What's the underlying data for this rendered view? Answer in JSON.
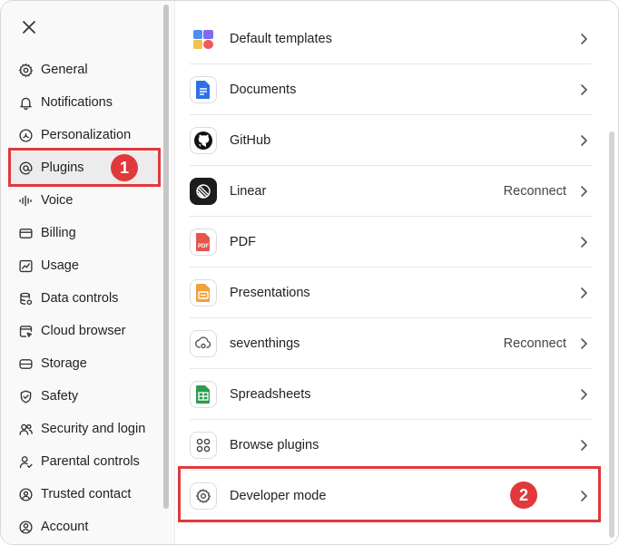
{
  "sidebar": {
    "items": [
      {
        "label": "General",
        "icon": "gear-icon"
      },
      {
        "label": "Notifications",
        "icon": "bell-icon"
      },
      {
        "label": "Personalization",
        "icon": "personalization-icon"
      },
      {
        "label": "Plugins",
        "icon": "at-sign-icon",
        "active": true
      },
      {
        "label": "Voice",
        "icon": "voice-waveform-icon"
      },
      {
        "label": "Billing",
        "icon": "card-icon"
      },
      {
        "label": "Usage",
        "icon": "chart-icon"
      },
      {
        "label": "Data controls",
        "icon": "database-icon"
      },
      {
        "label": "Cloud browser",
        "icon": "browser-icon"
      },
      {
        "label": "Storage",
        "icon": "storage-icon"
      },
      {
        "label": "Safety",
        "icon": "shield-icon"
      },
      {
        "label": "Security and login",
        "icon": "people-icon"
      },
      {
        "label": "Parental controls",
        "icon": "person-check-icon"
      },
      {
        "label": "Trusted contact",
        "icon": "contact-icon"
      },
      {
        "label": "Account",
        "icon": "account-icon"
      }
    ]
  },
  "plugins": [
    {
      "label": "Default templates",
      "status": "",
      "icon": "templates-icon"
    },
    {
      "label": "Documents",
      "status": "",
      "icon": "documents-icon"
    },
    {
      "label": "GitHub",
      "status": "",
      "icon": "github-icon"
    },
    {
      "label": "Linear",
      "status": "Reconnect",
      "icon": "linear-icon"
    },
    {
      "label": "PDF",
      "status": "",
      "icon": "pdf-icon"
    },
    {
      "label": "Presentations",
      "status": "",
      "icon": "presentations-icon"
    },
    {
      "label": "seventhings",
      "status": "Reconnect",
      "icon": "seventhings-icon"
    },
    {
      "label": "Spreadsheets",
      "status": "",
      "icon": "spreadsheets-icon"
    },
    {
      "label": "Browse plugins",
      "status": "",
      "icon": "grid-icon"
    },
    {
      "label": "Developer mode",
      "status": "",
      "icon": "gear-icon"
    }
  ],
  "pdf_icon_text": "PDF",
  "annotations": {
    "badge1": "1",
    "badge2": "2"
  },
  "colors": {
    "annotation": "#e0393c",
    "active_bg": "#ececec"
  }
}
